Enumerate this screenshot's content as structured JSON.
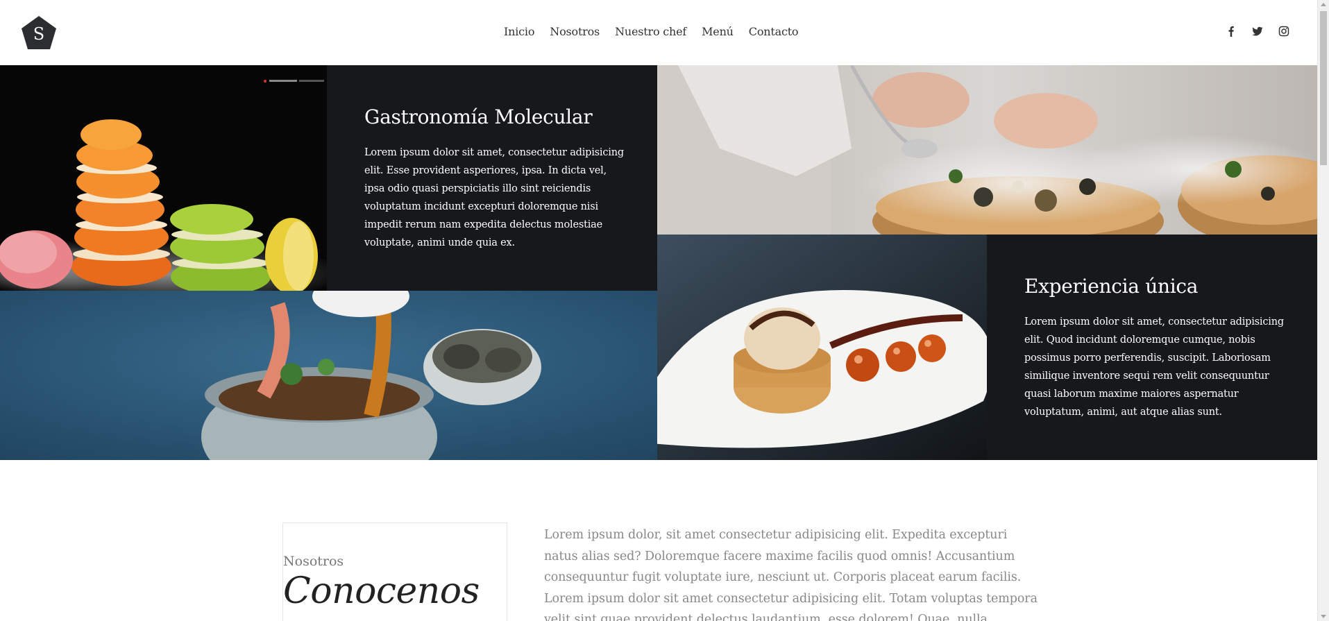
{
  "header": {
    "logo_letter": "S",
    "nav": [
      "Inicio",
      "Nosotros",
      "Nuestro chef",
      "Menú",
      "Contacto"
    ],
    "social": [
      "facebook-icon",
      "twitter-icon",
      "instagram-icon"
    ]
  },
  "hero": {
    "tile1": {
      "title": "Gastronomía Molecular",
      "text": "Lorem ipsum dolor sit amet, consectetur adipisicing elit. Esse provident asperiores, ipsa. In dicta vel, ipsa odio quasi perspiciatis illo sint reiciendis voluptatum incidunt excepturi doloremque nisi impedit rerum nam expedita delectus molestiae voluptate, animi unde quia ex."
    },
    "tile2": {
      "title": "Experiencia única",
      "text": "Lorem ipsum dolor sit amet, consectetur adipisicing elit. Quod incidunt doloremque cumque, nobis possimus porro perferendis, suscipit. Laboriosam similique inventore sequi rem velit consequuntur quasi laborum maxime maiores aspernatur voluptatum, animi, aut atque alias sunt."
    }
  },
  "about": {
    "subtitle": "Nosotros",
    "title": "Conocenos",
    "text": "Lorem ipsum dolor, sit amet consectetur adipisicing elit. Expedita excepturi natus alias sed? Doloremque facere maxime facilis quod omnis! Accusantium consequuntur fugit voluptate iure, nesciunt ut. Corporis placeat earum facilis. Lorem ipsum dolor sit amet consectetur adipisicing elit. Totam voluptas tempora velit sint quae provident delectus laudantium, esse dolorem! Quae, nulla voluptate quo beatae molestias facilis sit."
  },
  "colors": {
    "dark_panel": "#17181b",
    "logo": "#2b2d31"
  }
}
